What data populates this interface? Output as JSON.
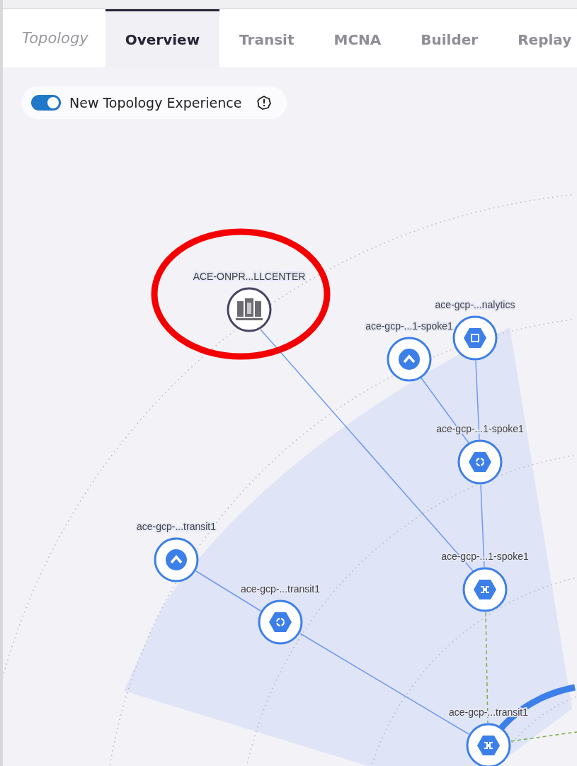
{
  "header": {
    "title": "Topology"
  },
  "tabs": [
    {
      "label": "Overview",
      "selected": true
    },
    {
      "label": "Transit",
      "selected": false
    },
    {
      "label": "MCNA",
      "selected": false
    },
    {
      "label": "Builder",
      "selected": false
    },
    {
      "label": "Replay",
      "selected": false
    }
  ],
  "toggle": {
    "label": "New Topology Experience",
    "on": true
  },
  "nodes": [
    {
      "label": "ACE-ONPR...LLCENTER",
      "kind": "onprem"
    },
    {
      "label": "ace-gcp-...nalytics",
      "kind": "chip"
    },
    {
      "label": "ace-gcp-...1-spoke1",
      "kind": "vpc"
    },
    {
      "label": "ace-gcp-...1-spoke1",
      "kind": "sync"
    },
    {
      "label": "ace-gcp-...transit1",
      "kind": "vpc"
    },
    {
      "label": "ace-gcp-...transit1",
      "kind": "sync"
    },
    {
      "label": "ace-gcp-...1-spoke1",
      "kind": "gateway"
    },
    {
      "label": "ace-gcp-...transit1",
      "kind": "gateway"
    }
  ]
}
